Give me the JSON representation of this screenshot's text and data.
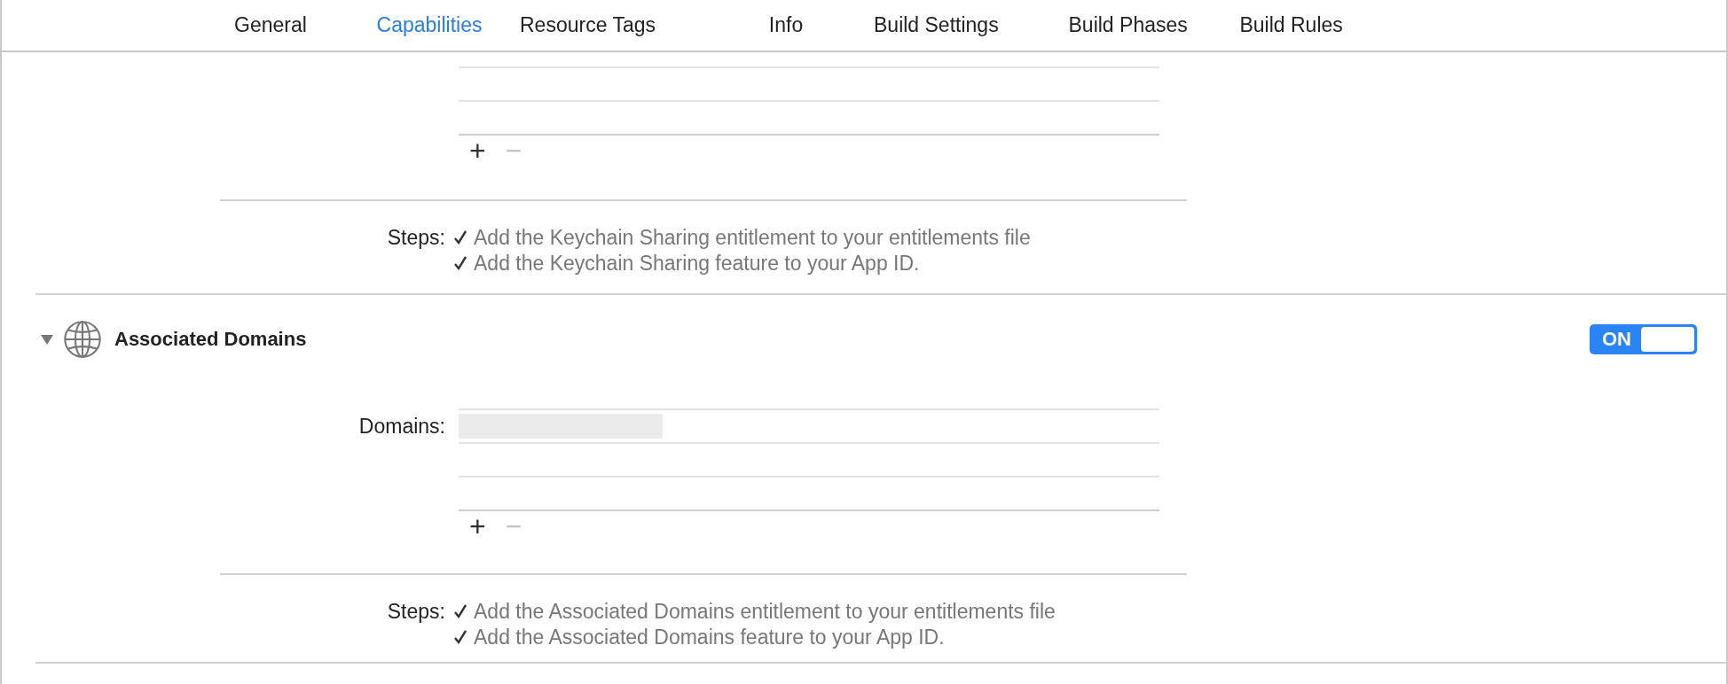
{
  "tabs": [
    {
      "label": "General",
      "selected": false
    },
    {
      "label": "Capabilities",
      "selected": true
    },
    {
      "label": "Resource Tags",
      "selected": false
    },
    {
      "label": "Info",
      "selected": false
    },
    {
      "label": "Build Settings",
      "selected": false
    },
    {
      "label": "Build Phases",
      "selected": false
    },
    {
      "label": "Build Rules",
      "selected": false
    }
  ],
  "keychain_sharing": {
    "list": {
      "rows": [
        {
          "redacted": false
        },
        {
          "redacted": false
        },
        {
          "redacted": false
        }
      ],
      "add_button": "+",
      "remove_button": "−"
    },
    "steps_label": "Steps:",
    "steps": [
      {
        "text": "Add the Keychain Sharing entitlement to your entitlements file",
        "completed": true
      },
      {
        "text": "Add the Keychain Sharing feature to your App ID.",
        "completed": true
      }
    ]
  },
  "associated_domains": {
    "title": "Associated Domains",
    "expanded": true,
    "switch": {
      "label": "ON",
      "on": true
    },
    "list_label": "Domains:",
    "list": {
      "rows": [
        {
          "redacted": true
        },
        {
          "redacted": false
        },
        {
          "redacted": false
        }
      ],
      "add_button": "+",
      "remove_button": "−"
    },
    "steps_label": "Steps:",
    "steps": [
      {
        "text": "Add the Associated Domains entitlement to your entitlements file",
        "completed": true
      },
      {
        "text": "Add the Associated Domains feature to your App ID.",
        "completed": true
      }
    ]
  }
}
